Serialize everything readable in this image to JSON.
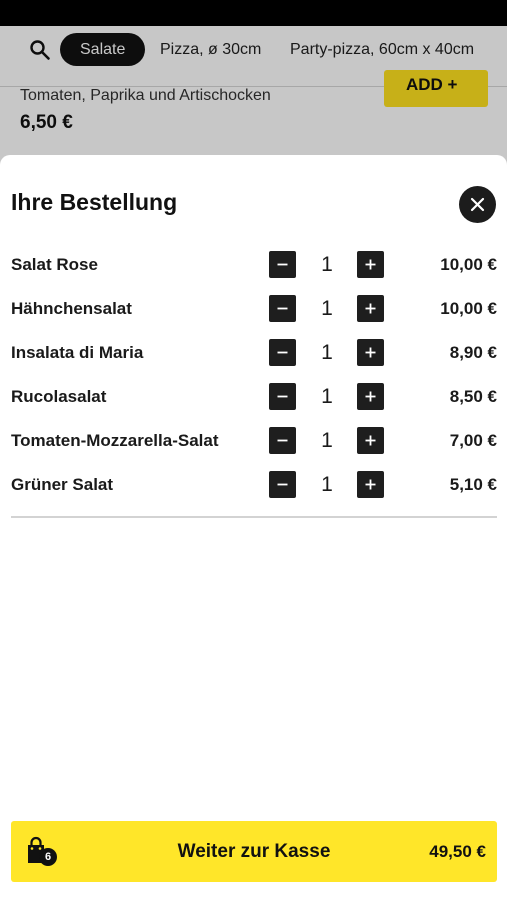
{
  "categories": {
    "active": "Salate",
    "tabs": [
      "Pizza, ø 30cm",
      "Party-pizza, 60cm x 40cm"
    ]
  },
  "background_item": {
    "description": "Tomaten, Paprika und Artischocken",
    "price": "6,50 €",
    "add_label": "ADD +"
  },
  "order": {
    "title": "Ihre Bestellung",
    "items": [
      {
        "name": "Salat Rose",
        "qty": "1",
        "price": "10,00 €"
      },
      {
        "name": "Hähnchensalat",
        "qty": "1",
        "price": "10,00 €"
      },
      {
        "name": "Insalata di Maria",
        "qty": "1",
        "price": "8,90 €"
      },
      {
        "name": "Rucolasalat",
        "qty": "1",
        "price": "8,50 €"
      },
      {
        "name": "Tomaten-Mozzarella-Salat",
        "qty": "1",
        "price": "7,00 €"
      },
      {
        "name": "Grüner Salat",
        "qty": "1",
        "price": "5,10 €"
      }
    ]
  },
  "checkout": {
    "label": "Weiter zur Kasse",
    "total": "49,50 €",
    "cart_count": "6"
  },
  "icons": {
    "search": "search-icon",
    "close": "close-icon",
    "minus": "minus-icon",
    "plus": "plus-icon",
    "bag": "shopping-bag-icon"
  },
  "colors": {
    "accent_yellow": "#ffe629",
    "dark": "#1c1c1c"
  }
}
